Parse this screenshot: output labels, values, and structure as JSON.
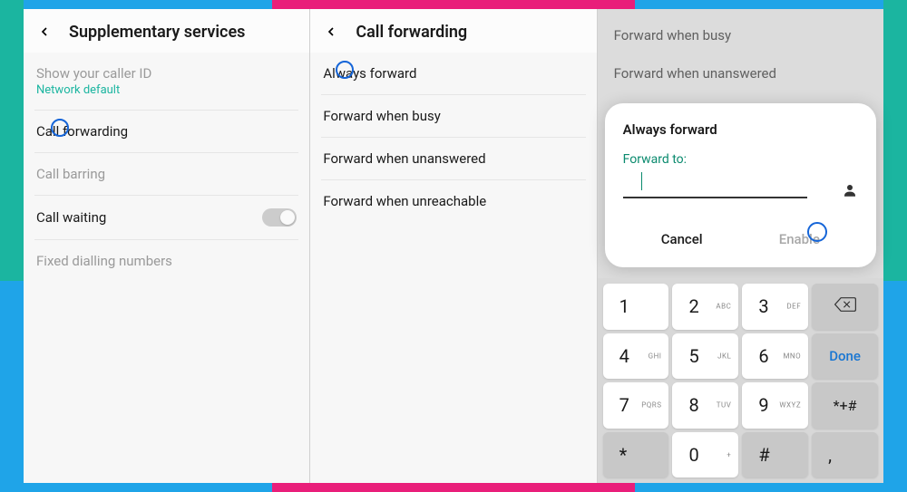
{
  "screen1": {
    "title": "Supplementary services",
    "items": [
      {
        "title": "Show your caller ID",
        "subtitle": "Network default"
      },
      {
        "title": "Call forwarding"
      },
      {
        "title": "Call barring"
      },
      {
        "title": "Call waiting"
      },
      {
        "title": "Fixed dialling numbers"
      }
    ]
  },
  "screen2": {
    "title": "Call forwarding",
    "items": [
      {
        "title": "Always forward"
      },
      {
        "title": "Forward when busy"
      },
      {
        "title": "Forward when unanswered"
      },
      {
        "title": "Forward when unreachable"
      }
    ]
  },
  "screen3": {
    "bg_items": [
      "Forward when busy",
      "Forward when unanswered"
    ],
    "dialog": {
      "title": "Always forward",
      "label": "Forward to:",
      "cancel": "Cancel",
      "enable": "Enable"
    }
  },
  "keypad": {
    "rows": [
      [
        {
          "n": "1",
          "s": ""
        },
        {
          "n": "2",
          "s": "ABC"
        },
        {
          "n": "3",
          "s": "DEF"
        },
        {
          "type": "backspace"
        }
      ],
      [
        {
          "n": "4",
          "s": "GHI"
        },
        {
          "n": "5",
          "s": "JKL"
        },
        {
          "n": "6",
          "s": "MNO"
        },
        {
          "type": "done",
          "label": "Done"
        }
      ],
      [
        {
          "n": "7",
          "s": "PQRS"
        },
        {
          "n": "8",
          "s": "TUV"
        },
        {
          "n": "9",
          "s": "WXYZ"
        },
        {
          "type": "sym",
          "label": "*+#"
        }
      ],
      [
        {
          "type": "gray",
          "n": "*",
          "s": ""
        },
        {
          "n": "0",
          "s": "+"
        },
        {
          "type": "gray",
          "n": "#",
          "s": ""
        },
        {
          "type": "gray",
          "n": ",",
          "s": ""
        }
      ]
    ]
  }
}
